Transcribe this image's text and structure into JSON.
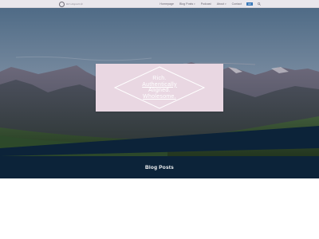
{
  "header": {
    "logo_text": "Rich Aligned Life",
    "nav": [
      {
        "label": "Homepage",
        "has_dropdown": false
      },
      {
        "label": "Blog Posts",
        "has_dropdown": true
      },
      {
        "label": "Podcast",
        "has_dropdown": false
      },
      {
        "label": "About",
        "has_dropdown": true
      },
      {
        "label": "Contact",
        "has_dropdown": false
      }
    ],
    "language_flag": "EN",
    "search_icon": "search-icon"
  },
  "hero": {
    "badge_lines": [
      "Rich.",
      "Authentically",
      "Aligned.",
      "Wholesome."
    ]
  },
  "sections": {
    "posts_title": "Blog Posts"
  },
  "colors": {
    "topbar": "#e9e7ec",
    "badge_bg": "#e9d7e2",
    "posts_band": "#0c2339"
  }
}
